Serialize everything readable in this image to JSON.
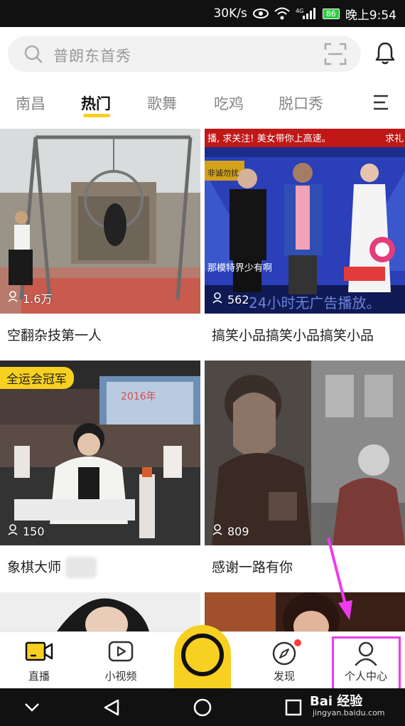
{
  "status_bar": {
    "speed": "30K/s",
    "signal_label": "4G",
    "battery": "86",
    "time": "晚上9:54"
  },
  "search": {
    "placeholder": "普朗东首秀"
  },
  "tabs": [
    {
      "label": "南昌",
      "active": false
    },
    {
      "label": "热门",
      "active": true
    },
    {
      "label": "歌舞",
      "active": false
    },
    {
      "label": "吃鸡",
      "active": false
    },
    {
      "label": "脱口秀",
      "active": false
    }
  ],
  "cards": [
    {
      "title": "空翻杂技第一人",
      "viewers": "1.6万",
      "badge": ""
    },
    {
      "title": "搞笑小品搞笑小品搞笑小品",
      "viewers": "562",
      "badge": "",
      "overlay_top": "播, 求关注! 美女带你上高速。",
      "overlay_top_right": "求礼",
      "overlay_bottom": "24小时无广告播放。",
      "overlay_caption": "那模特界少有啊",
      "logo_text": "非诚勿扰"
    },
    {
      "title": "象棋大师",
      "viewers": "150",
      "badge": "全运会冠军",
      "banner_text": "2016年"
    },
    {
      "title": "感谢一路有你",
      "viewers": "809",
      "badge": ""
    }
  ],
  "bottom_nav": {
    "live": "直播",
    "short_video": "小视频",
    "discover": "发现",
    "profile": "个人中心"
  },
  "watermark": {
    "brand": "Bai 经验",
    "url": "jingyan.baidu.com"
  },
  "colors": {
    "accent": "#f7d021",
    "annotation": "#ee3bf0"
  }
}
